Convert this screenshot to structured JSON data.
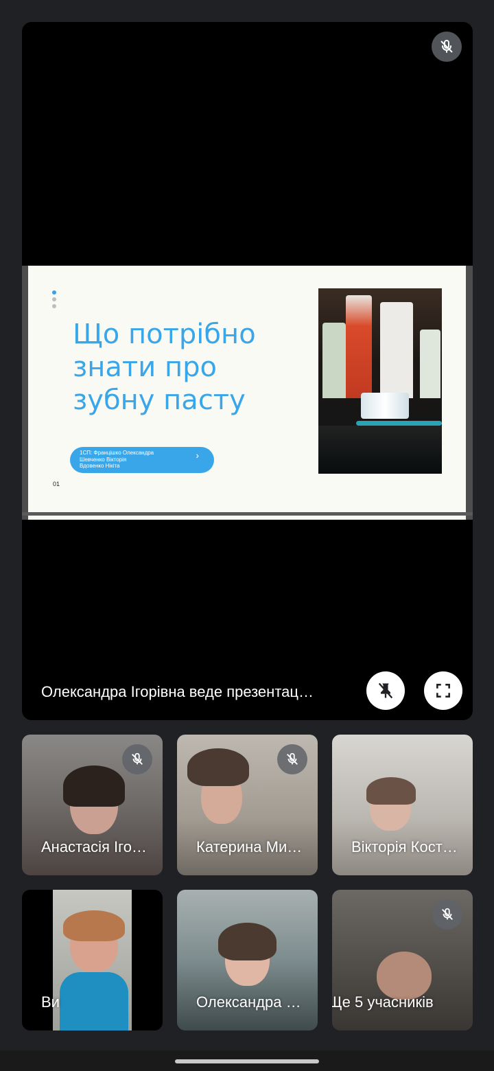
{
  "presentation": {
    "presenter_label": "Олександра Ігорівна веде презентац…",
    "slide": {
      "title_line1": "Що потрібно",
      "title_line2": "знати про",
      "title_line3": "зубну пасту",
      "authors_line1": "1СП: Францішко Олександра",
      "authors_line2": "Шевченко Вікторія",
      "authors_line3": "Вдовенко Нікіта",
      "chevron": "›",
      "number": "01"
    },
    "icons": {
      "mic": "mic-off-icon",
      "unpin": "unpin-icon",
      "fullscreen": "fullscreen-icon"
    }
  },
  "participants": [
    {
      "name": "Анастасія Іго…",
      "muted": true
    },
    {
      "name": "Катерина Ми…",
      "muted": true
    },
    {
      "name": "Вікторія Кост…",
      "muted": false
    },
    {
      "name": "Ви",
      "muted": false
    },
    {
      "name": "Олександра …",
      "muted": false
    },
    {
      "name": "Ще 5 учасників",
      "muted": true
    }
  ],
  "colors": {
    "background": "#202124",
    "slide_accent": "#3aa6ea"
  }
}
